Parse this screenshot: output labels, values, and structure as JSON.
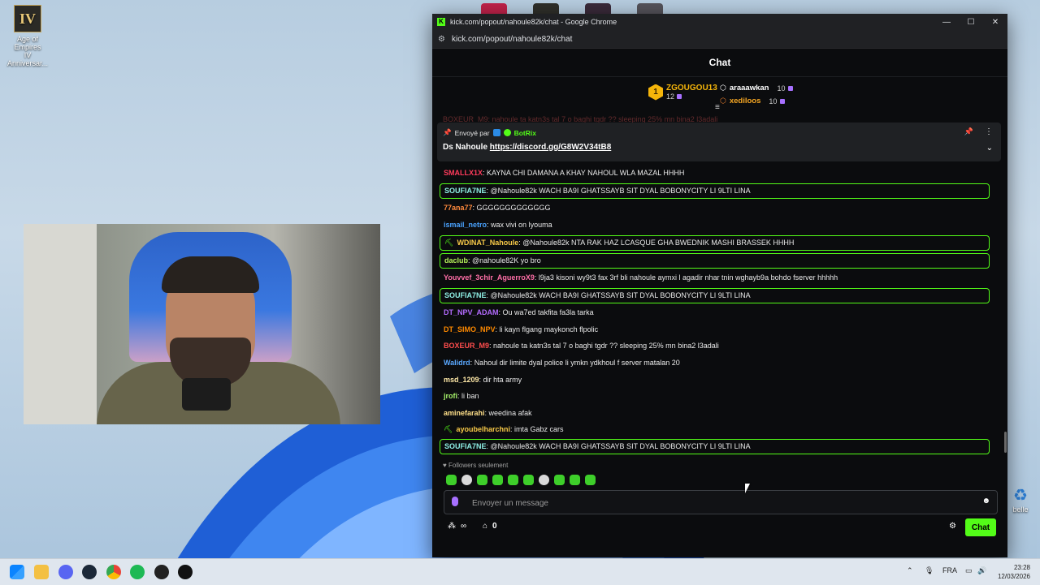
{
  "desktop": {
    "icon_label_1": "Age of Empires",
    "icon_label_2": "IV Anniversar...",
    "icon_glyph": "IV",
    "recycle_label": "belle"
  },
  "window": {
    "title": "kick.com/popout/nahoule82k/chat - Google Chrome",
    "url": "kick.com/popout/nahoule82k/chat",
    "logo": "K"
  },
  "chat": {
    "header": "Chat",
    "leaderboard": {
      "first": {
        "rank": "1",
        "name": "ZGOUGOU13",
        "value": "12"
      },
      "second": {
        "name": "araaawkan",
        "value": "10"
      },
      "third": {
        "name": "xediloos",
        "value": "10"
      }
    },
    "hidden_line": "BOXEUR_M9: nahoule ta katn3s tal 7 o baghi tgdr ?? sleeping 25% mn bina2 l3adali",
    "pinned": {
      "sent_by": "Envoyé par",
      "bot": "BotRix",
      "text": "Ds Nahoule",
      "link": "https://discord.gg/G8W2V34tB8"
    },
    "messages": [
      {
        "user": "SMALLX1X",
        "color": "#ff3b5c",
        "text": "KAYNA CHI DAMANA A KHAY NAHOUL WLA MAZAL HHHH",
        "hl": false,
        "icon": ""
      },
      {
        "user": "SOUFIA7NE",
        "color": "#8ff0e6",
        "text": "@Nahoule82k WACH BA9I GHATSSAYB SIT DYAL BOBONYCITY LI 9LTI LINA",
        "hl": true,
        "icon": ""
      },
      {
        "user": "77ana77",
        "color": "#ff8a3d",
        "text": "GGGGGGGGGGGGG",
        "hl": false,
        "icon": ""
      },
      {
        "user": "ismail_netro",
        "color": "#4aa3ff",
        "text": "wax vivi on lyouma",
        "hl": false,
        "icon": ""
      },
      {
        "user": "WDINAT_Nahoule",
        "color": "#f7c948",
        "text": "@Nahoule82k NTA RAK HAZ LCASQUE GHA BWEDNIK MASHI BRASSEK HHHH",
        "hl": true,
        "icon": "⛏"
      },
      {
        "user": "daclub",
        "color": "#b7f55b",
        "text": "@nahoule82K yo bro",
        "hl": true,
        "icon": ""
      },
      {
        "user": "Youvvef_3chir_AguerroX9",
        "color": "#ff6fa8",
        "text": "l9ja3 kisoni wy9t3 fax 3rf bli nahoule aymxi l agadir nhar tnin wghayb9a bohdo fserver hhhhh",
        "hl": false,
        "icon": ""
      },
      {
        "user": "SOUFIA7NE",
        "color": "#8ff0e6",
        "text": "@Nahoule82k WACH BA9I GHATSSAYB SIT DYAL BOBONYCITY LI 9LTI LINA",
        "hl": true,
        "icon": ""
      },
      {
        "user": "DT_NPV_ADAM",
        "color": "#b36bff",
        "text": "Ou wa7ed takfita fa3la tarka",
        "hl": false,
        "icon": ""
      },
      {
        "user": "DT_SIMO_NPV",
        "color": "#ff8a00",
        "text": "li kayn flgang maykonch flpolic",
        "hl": false,
        "icon": ""
      },
      {
        "user": "BOXEUR_M9",
        "color": "#ff4d4d",
        "text": "nahoule ta katn3s tal 7 o baghi tgdr ?? sleeping 25% mn bina2 l3adali",
        "hl": false,
        "icon": ""
      },
      {
        "user": "Walidrd",
        "color": "#5aa8ff",
        "text": "Nahoul dir limite dyal police li ymkn ydkhoul f server matalan 20",
        "hl": false,
        "icon": ""
      },
      {
        "user": "msd_1209",
        "color": "#ffe9a8",
        "text": "dir hta army",
        "hl": false,
        "icon": ""
      },
      {
        "user": "jrofi",
        "color": "#a6f26a",
        "text": "li ban",
        "hl": false,
        "icon": ""
      },
      {
        "user": "aminefarahi",
        "color": "#ffe08a",
        "text": "weedina afak",
        "hl": false,
        "icon": ""
      },
      {
        "user": "ayoubelharchni",
        "color": "#f7c948",
        "text": "imta Gabz cars",
        "hl": false,
        "icon": "⛏"
      },
      {
        "user": "SOUFIA7NE",
        "color": "#8ff0e6",
        "text": "@Nahoule82k WACH BA9I GHATSSAYB SIT DYAL BOBONYCITY LI 9LTI LINA",
        "hl": true,
        "icon": ""
      }
    ],
    "followers_only": "Followers seulement",
    "input_placeholder": "Envoyer un message",
    "infinity": "∞",
    "store_count": "0",
    "send_label": "Chat"
  },
  "taskbar": {
    "lang": "FRA",
    "time": "23:28",
    "date": "12/03/2026"
  },
  "colors": {
    "accent": "#53fc18",
    "window_bg": "#0b0c0e",
    "gold": "#f5b50a"
  }
}
